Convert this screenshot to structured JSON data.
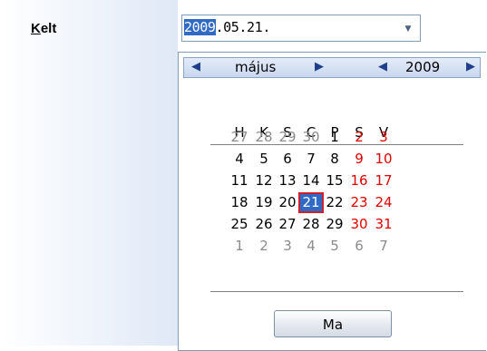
{
  "form": {
    "label_underlined": "K",
    "label_rest": "elt",
    "date_selected_part": "2009",
    "date_rest": ".05.21.",
    "dropdown_icon": "▼"
  },
  "calendar": {
    "prev_month_icon": "◀",
    "month": "május",
    "next_month_icon": "▶",
    "prev_year_icon": "◀",
    "year": "2009",
    "next_year_icon": "▶",
    "weekdays": [
      "H",
      "K",
      "S",
      "C",
      "P",
      "S",
      "V"
    ],
    "weeks": [
      [
        "27",
        "28",
        "29",
        "30",
        "1",
        "2",
        "3"
      ],
      [
        "4",
        "5",
        "6",
        "7",
        "8",
        "9",
        "10"
      ],
      [
        "11",
        "12",
        "13",
        "14",
        "15",
        "16",
        "17"
      ],
      [
        "18",
        "19",
        "20",
        "21",
        "22",
        "23",
        "24"
      ],
      [
        "25",
        "26",
        "27",
        "28",
        "29",
        "30",
        "31"
      ],
      [
        "1",
        "2",
        "3",
        "4",
        "5",
        "6",
        "7"
      ]
    ],
    "other_month_cells": [
      [
        0,
        0
      ],
      [
        0,
        1
      ],
      [
        0,
        2
      ],
      [
        0,
        3
      ],
      [
        5,
        0
      ],
      [
        5,
        1
      ],
      [
        5,
        2
      ],
      [
        5,
        3
      ],
      [
        5,
        4
      ],
      [
        5,
        5
      ],
      [
        5,
        6
      ]
    ],
    "selected_cell": [
      3,
      3
    ],
    "today_button_label": "Ma"
  },
  "colors": {
    "weekend": "#e00000",
    "other_month": "#8c8c8c",
    "selected_bg": "#316ac5",
    "selected_border": "#d0202c"
  }
}
